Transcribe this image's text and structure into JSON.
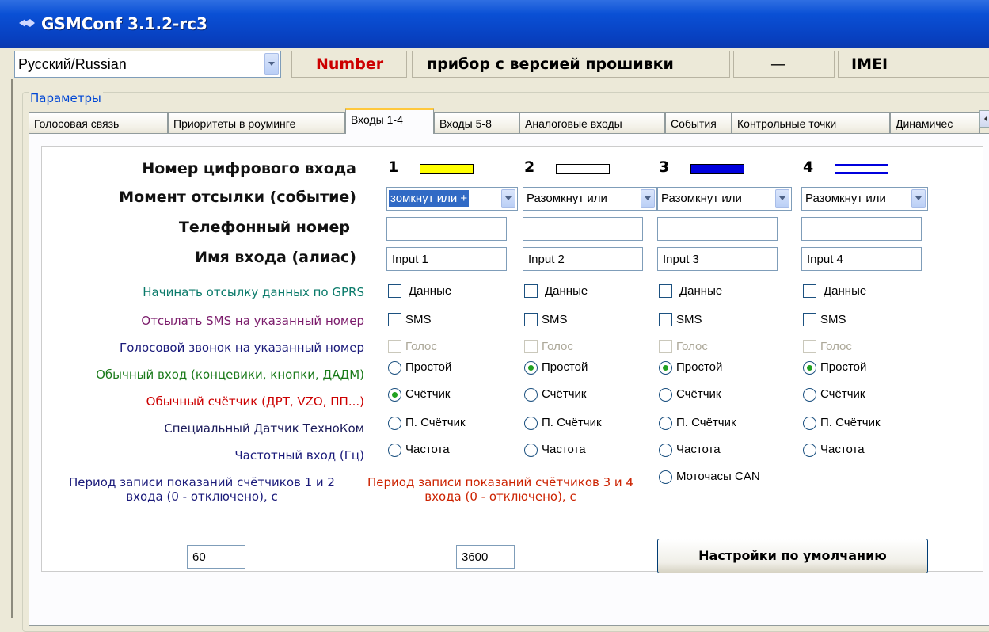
{
  "window": {
    "title": "GSMConf 3.1.2-rc3",
    "icon": "app-icon"
  },
  "header": {
    "language": "Русский/Russian",
    "number_label": "Number",
    "firmware_label": "прибор с версией прошивки",
    "firmware_value": "—",
    "imei_label": "IMEI",
    "number_color": "#cc0000"
  },
  "params": {
    "group_label": "Параметры"
  },
  "tabs": [
    "Голосовая связь",
    "Приоритеты в роуминге",
    "Входы 1-4",
    "Входы 5-8",
    "Аналоговые входы",
    "События",
    "Контрольные точки",
    "Динамичес"
  ],
  "active_tab": "Входы 1-4",
  "labels": {
    "digital_input_number": "Номер цифрового входа",
    "send_moment": "Момент отсылки (событие)",
    "phone_number": "Телефонный номер",
    "input_alias": "Имя входа (алиас)",
    "gprs": "Начинать отсылку данных по GPRS",
    "sms": "Отсылать SMS на указанный номер",
    "voice": "Голосовой звонок на указанный номер",
    "simple_input": "Обычный вход (концевики, кнопки, ДАДМ)",
    "counter": "Обычный счётчик (ДРТ, VZO, ПП...)",
    "special": "Специальный Датчик ТехноКом",
    "frequency": "Частотный вход (Гц)",
    "period_12": "Период записи показаний счётчиков 1 и 2",
    "period_12_b": "входа (0 - отключено), с",
    "period_34": "Период записи показаний счётчиков 3 и 4",
    "period_34_b": "входа (0 - отключено), с"
  },
  "label_colors": {
    "gprs": "#0a7a6a",
    "sms": "#7a1a6a",
    "voice": "#1a1a7a",
    "simple_input": "#1a7a1a",
    "counter": "#cc0000",
    "special": "#1a1a5a",
    "frequency": "#1a1a7a",
    "period_12": "#1a1a7a",
    "period_34": "#cc2200"
  },
  "inputs": [
    {
      "num": "1",
      "swatch": "#ffff00",
      "moment": "зомкнут или +",
      "moment_selected": true,
      "phone": "",
      "alias": "Input 1",
      "data_label": "Данные",
      "sms_label": "SMS",
      "voice_label": "Голос",
      "mode": "counter",
      "radios": [
        "Простой",
        "Счётчик",
        "П. Счётчик",
        "Частота"
      ]
    },
    {
      "num": "2",
      "swatch": "#ffffff",
      "moment": "Разомкнут или",
      "moment_selected": false,
      "phone": "",
      "alias": "Input 2",
      "data_label": "Данные",
      "sms_label": "SMS",
      "voice_label": "Голос",
      "mode": "simple",
      "radios": [
        "Простой",
        "Счётчик",
        "П. Счётчик",
        "Частота"
      ]
    },
    {
      "num": "3",
      "swatch": "#0000dd",
      "moment": "Разомкнут или",
      "moment_selected": false,
      "phone": "",
      "alias": "Input 3",
      "data_label": "Данные",
      "sms_label": "SMS",
      "voice_label": "Голос",
      "mode": "simple",
      "radios": [
        "Простой",
        "Счётчик",
        "П. Счётчик",
        "Частота",
        "Моточасы CAN"
      ]
    },
    {
      "num": "4",
      "swatch": "#0000dd",
      "moment": "Разомкнут или",
      "moment_selected": false,
      "phone": "",
      "alias": "Input 4",
      "data_label": "Данные",
      "sms_label": "SMS",
      "voice_label": "Голос",
      "mode": "simple",
      "radios": [
        "Простой",
        "Счётчик",
        "П. Счётчик",
        "Частота"
      ]
    }
  ],
  "period_12_value": "60",
  "period_34_value": "3600",
  "defaults_button": "Настройки по умолчанию"
}
